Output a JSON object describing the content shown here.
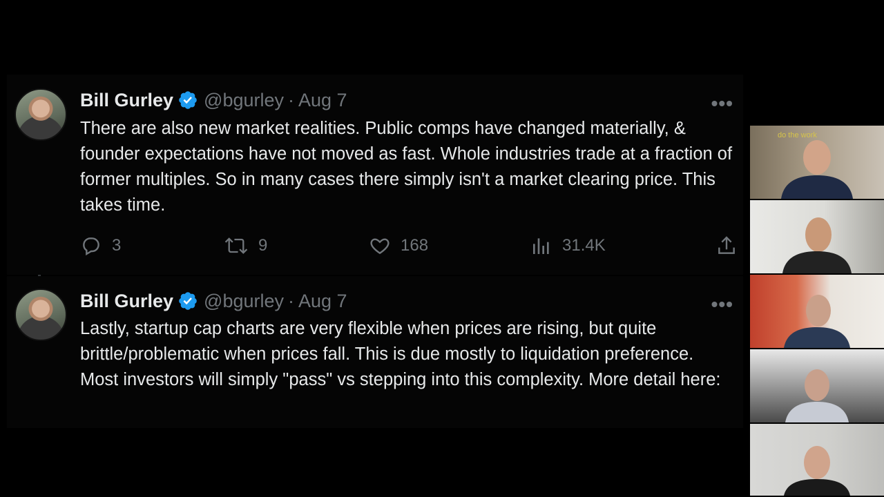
{
  "tweets": [
    {
      "name": "Bill Gurley",
      "handle": "@bgurley",
      "separator": "·",
      "date": "Aug 7",
      "more": "•••",
      "text": "There are also new market realities. Public comps have changed materially, & founder expectations have not moved as fast. Whole industries trade at a fraction of former multiples. So in many cases there simply isn't a market clearing price. This takes time.",
      "replies": "3",
      "retweets": "9",
      "likes": "168",
      "views": "31.4K"
    },
    {
      "name": "Bill Gurley",
      "handle": "@bgurley",
      "separator": "·",
      "date": "Aug 7",
      "more": "•••",
      "text": "Lastly, startup cap charts are very flexible when prices are rising, but quite brittle/problematic when prices fall. This is due mostly to liquidation preference. Most investors will simply \"pass\" vs stepping into this complexity. More detail here:"
    }
  ],
  "video_tiles": {
    "tile1_sign": "do the work"
  },
  "colors": {
    "background": "#000000",
    "text": "#e7e9ea",
    "muted": "#71767b",
    "verified": "#1d9bf0"
  }
}
